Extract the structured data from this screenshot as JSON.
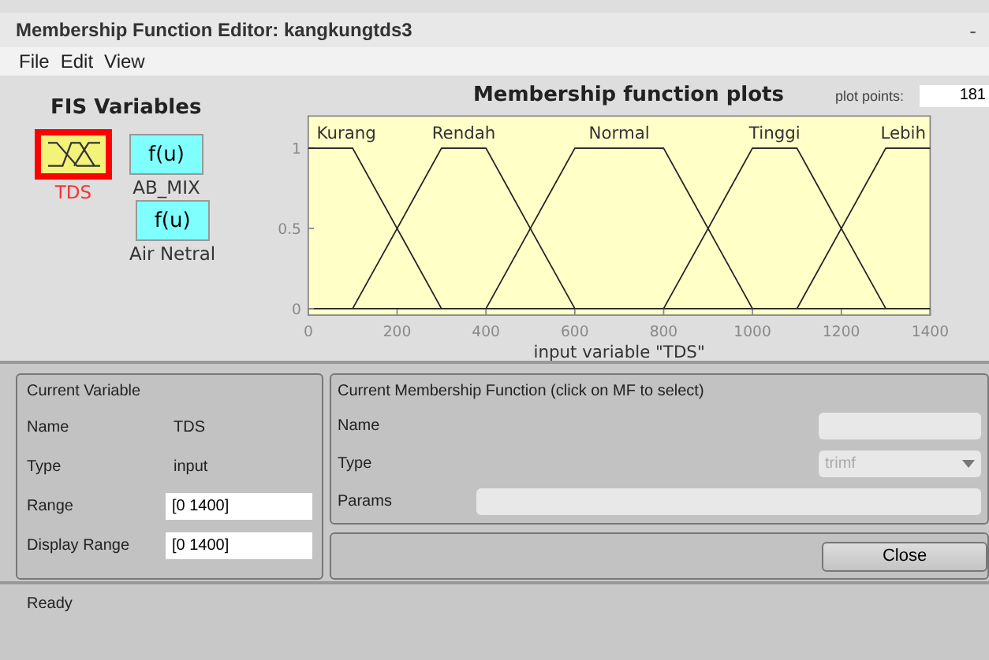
{
  "window": {
    "title": "Membership Function Editor: kangkungtds3",
    "control": "-"
  },
  "menu": [
    "File",
    "Edit",
    "View"
  ],
  "fis_variables": {
    "title": "FIS Variables",
    "items": [
      {
        "label": "TDS",
        "kind": "input",
        "selected": true
      },
      {
        "label": "AB_MIX",
        "kind": "output",
        "selected": false,
        "icon_text": "f(u)"
      },
      {
        "label": "Air Netral",
        "kind": "output",
        "selected": false,
        "icon_text": "f(u)"
      }
    ]
  },
  "plot": {
    "title": "Membership function plots",
    "plot_points_label": "plot points:",
    "plot_points": "181",
    "chart_data": {
      "type": "line",
      "xlabel": "input variable \"TDS\"",
      "x": [
        0,
        100,
        200,
        300,
        400,
        500,
        600,
        700,
        800,
        900,
        1000,
        1100,
        1200,
        1300,
        1400
      ],
      "series": [
        {
          "name": "Kurang",
          "values": [
            1,
            1,
            0.5,
            0,
            null,
            null,
            null,
            null,
            null,
            null,
            null,
            null,
            null,
            null,
            null
          ]
        },
        {
          "name": "Rendah",
          "values": [
            null,
            0,
            0.5,
            1,
            1,
            0.5,
            0,
            null,
            null,
            null,
            null,
            null,
            null,
            null,
            null
          ]
        },
        {
          "name": "Normal",
          "values": [
            null,
            null,
            null,
            null,
            0,
            0.5,
            1,
            1,
            1,
            0.5,
            0,
            null,
            null,
            null,
            null
          ]
        },
        {
          "name": "Tinggi",
          "values": [
            null,
            null,
            null,
            null,
            null,
            null,
            null,
            null,
            0,
            0.5,
            1,
            1,
            0.5,
            0,
            null
          ]
        },
        {
          "name": "Lebih",
          "values": [
            null,
            null,
            null,
            null,
            null,
            null,
            null,
            null,
            null,
            null,
            null,
            0,
            0.5,
            1,
            1
          ]
        }
      ],
      "xlim": [
        0,
        1400
      ],
      "ylim": [
        -0.04,
        1.2
      ],
      "xticks": [
        0,
        200,
        400,
        600,
        800,
        1000,
        1200,
        1400
      ],
      "yticks": [
        0,
        0.5,
        1
      ]
    }
  },
  "current_variable": {
    "title": "Current Variable",
    "name_label": "Name",
    "name": "TDS",
    "type_label": "Type",
    "type": "input",
    "range_label": "Range",
    "range": "[0 1400]",
    "display_range_label": "Display Range",
    "display_range": "[0 1400]"
  },
  "current_mf": {
    "title": "Current Membership Function (click on MF to select)",
    "name_label": "Name",
    "type_label": "Type",
    "type": "trimf",
    "params_label": "Params"
  },
  "buttons": [
    "Close"
  ],
  "status_bar": "Ready"
}
